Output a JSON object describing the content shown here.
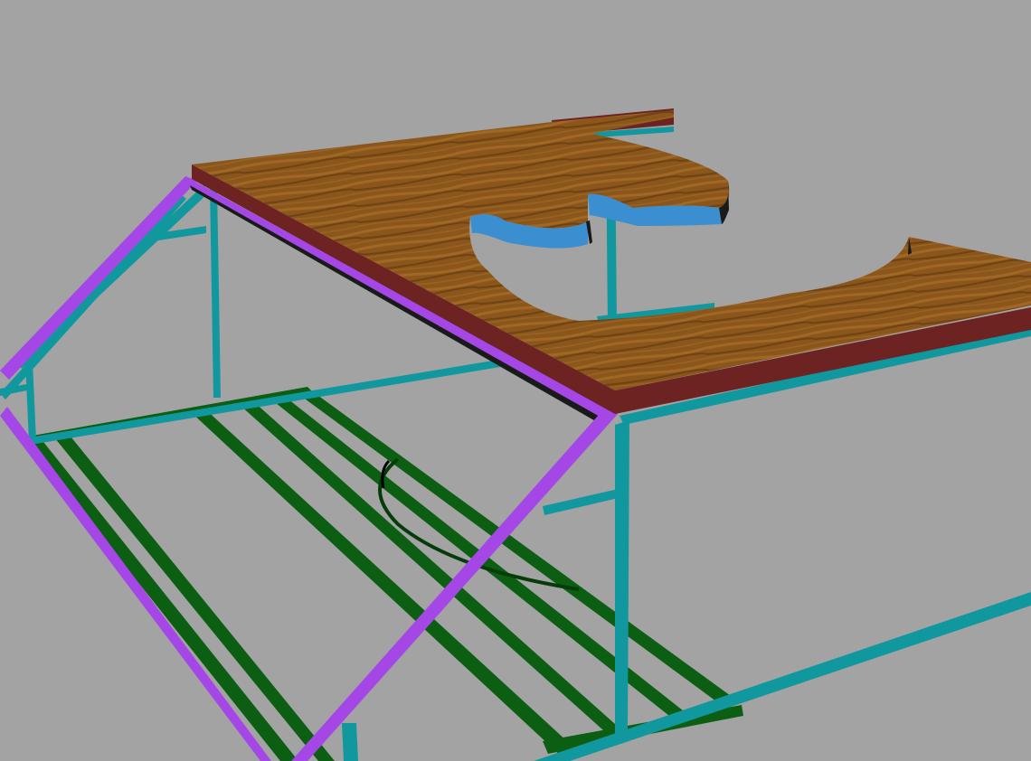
{
  "colors": {
    "background": "#a3a3a3",
    "frame_teal": "#11979e",
    "frame_teal_dark": "#0a6f75",
    "rail_purple": "#a547e6",
    "rail_purple_dark": "#7a2cb3",
    "slat_green": "#0b5e12",
    "slat_green_dark": "#053d09",
    "top_wood": "#8a561b",
    "top_wood_light": "#a06824",
    "top_edge": "#6e2323",
    "cutout_blue": "#3b8fd1"
  },
  "scene": {
    "objects": [
      "wooden-tabletop",
      "teal-frame",
      "purple-rails",
      "green-slats",
      "slatted-shelf"
    ]
  }
}
